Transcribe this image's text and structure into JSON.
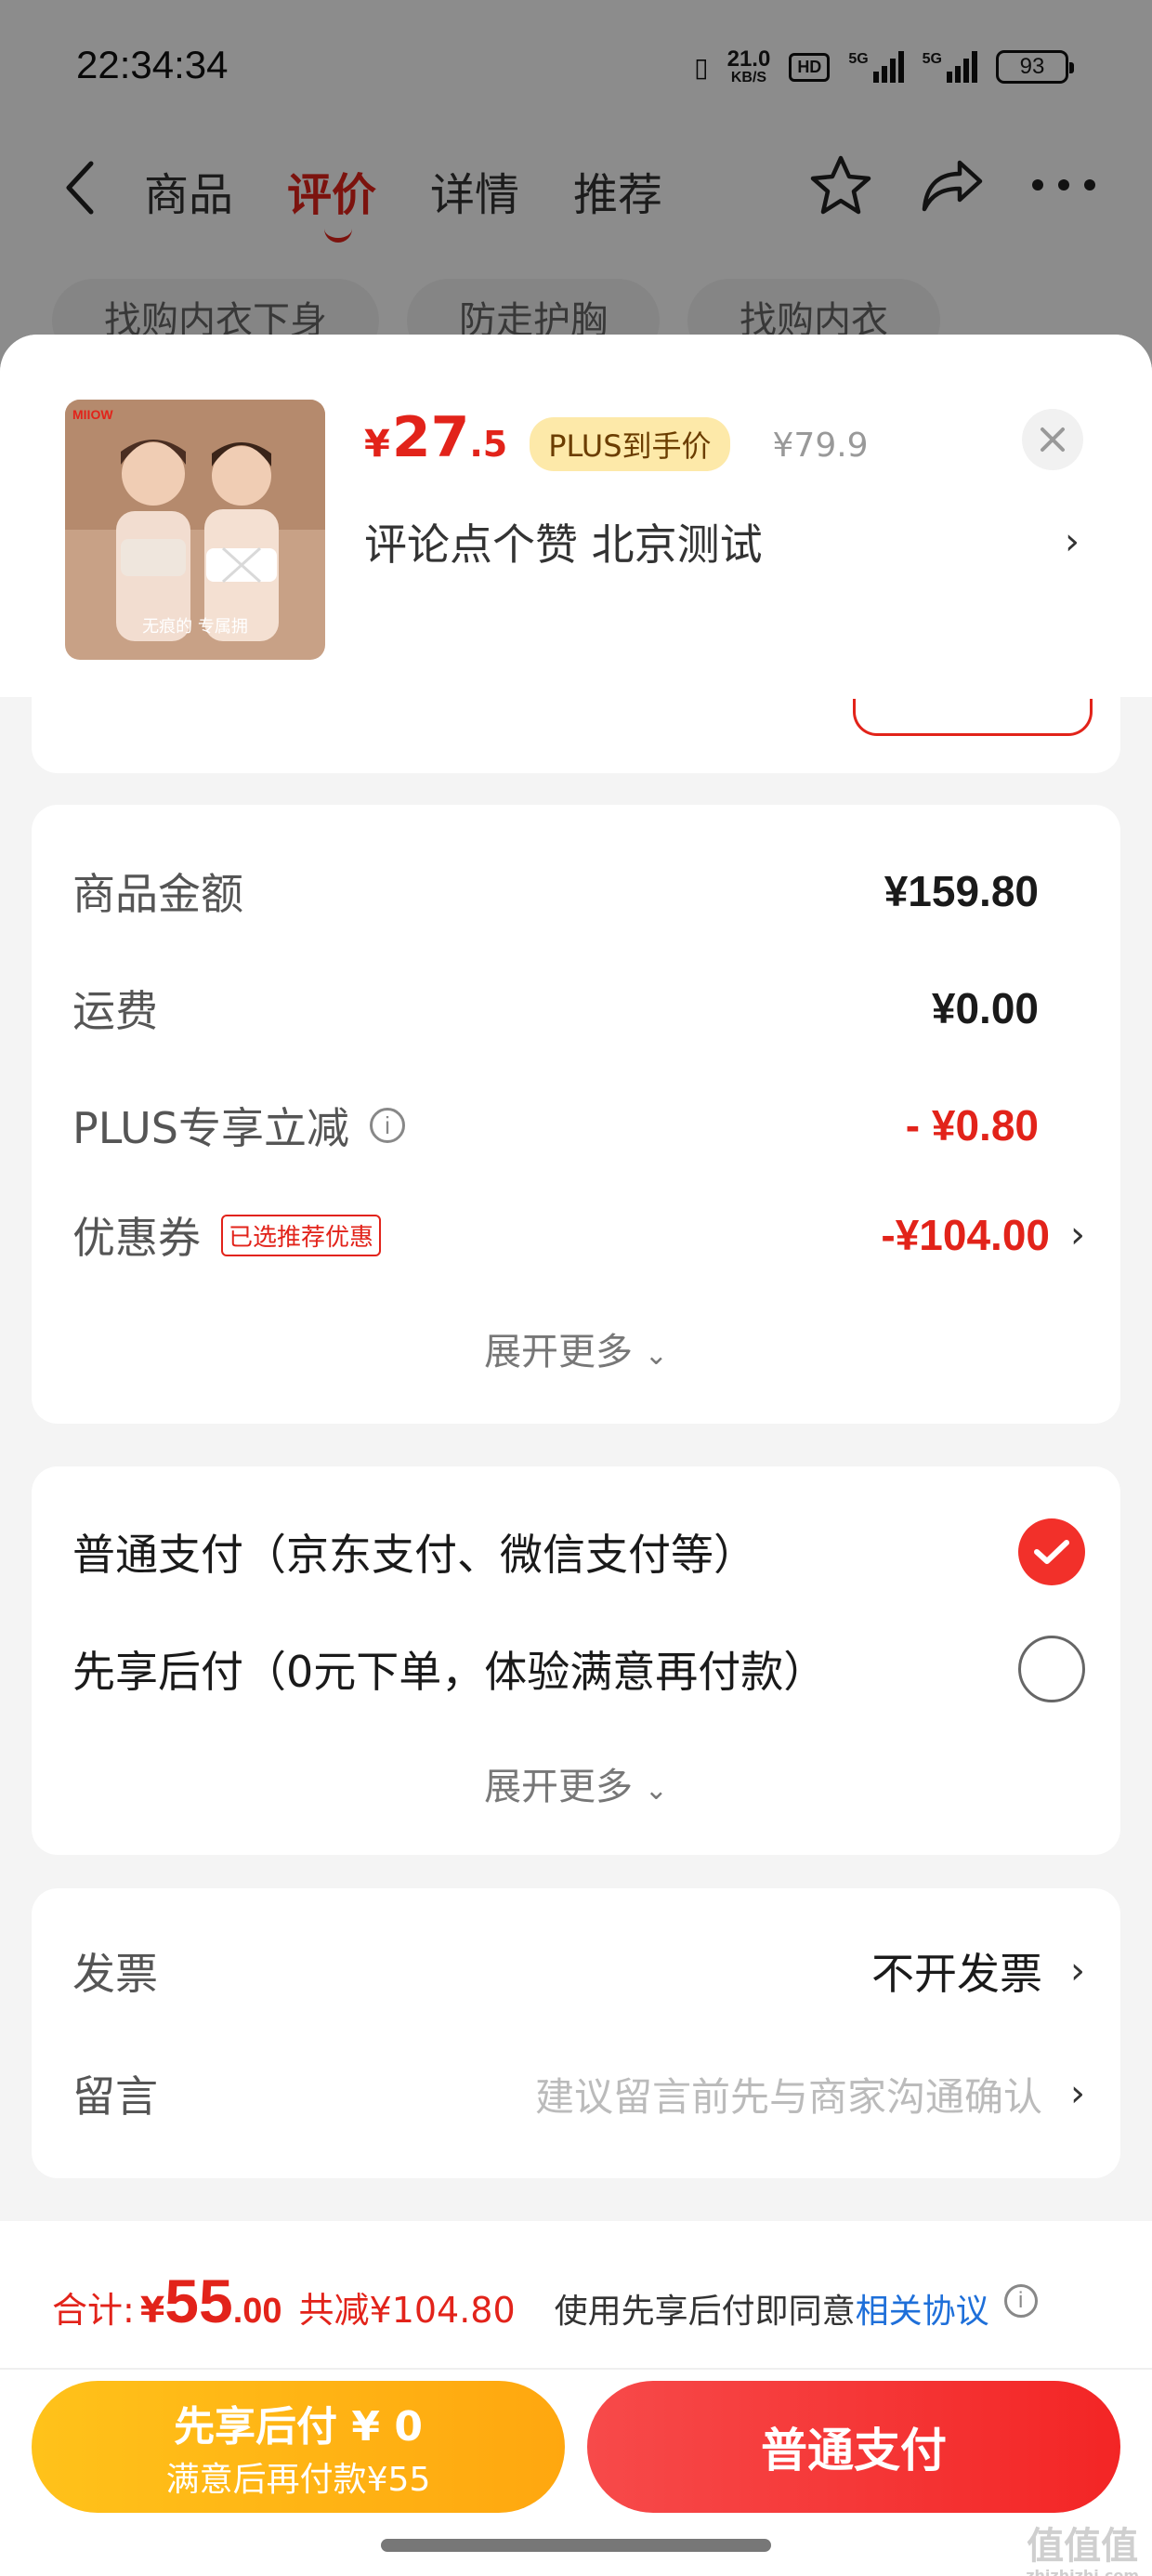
{
  "status_bar": {
    "time": "22:34:34",
    "net_speed_value": "21.0",
    "net_speed_unit": "KB/S",
    "hd_label": "HD",
    "signal1_label": "5G",
    "signal2_label": "5G",
    "battery": "93"
  },
  "nav": {
    "tabs": [
      "商品",
      "评价",
      "详情",
      "推荐"
    ],
    "active_tab": "评价"
  },
  "background_chips": [
    "找购内衣下身",
    "防走护胸",
    "找购内衣"
  ],
  "product": {
    "price_symbol": "¥",
    "price_integer": "27",
    "price_decimal": ".5",
    "plus_badge": "PLUS到手价",
    "original_price": "¥79.9",
    "name": "评论点个赞  北京测试",
    "brand_logo_text": "MIIOW",
    "thumb_caption": "无痕的 专属拥"
  },
  "amounts": {
    "goods_label": "商品金额",
    "goods_value": "¥159.80",
    "shipping_label": "运费",
    "shipping_value": "¥0.00",
    "plus_label": "PLUS专享立减",
    "plus_value": "- ¥0.80",
    "coupon_label": "优惠券",
    "coupon_tag": "已选推荐优惠",
    "coupon_value": "-¥104.00",
    "expand_more": "展开更多"
  },
  "payment": {
    "options": [
      {
        "label": "普通支付（京东支付、微信支付等）",
        "selected": true
      },
      {
        "label": "先享后付（0元下单，体验满意再付款）",
        "selected": false
      }
    ],
    "expand_more": "展开更多"
  },
  "invoice": {
    "invoice_label": "发票",
    "invoice_value": "不开发票",
    "message_label": "留言",
    "message_placeholder": "建议留言前先与商家沟通确认"
  },
  "bottom": {
    "total_label": "合计:",
    "total_symbol": "¥",
    "total_integer": "55",
    "total_decimal": ".00",
    "total_reduce": "共减¥104.80",
    "agree_text": "使用先享后付即同意",
    "agree_link": "相关协议",
    "btn_later_line1": "先享后付 ¥ 0",
    "btn_later_line2": "满意后再付款¥55",
    "btn_pay": "普通支付"
  },
  "watermark": {
    "main": "值值值",
    "sub": "zhizhizhi.com"
  },
  "colors": {
    "brand_red": "#e2231a",
    "link_blue": "#1e6fd9",
    "later_yellow": "#ffb814"
  }
}
